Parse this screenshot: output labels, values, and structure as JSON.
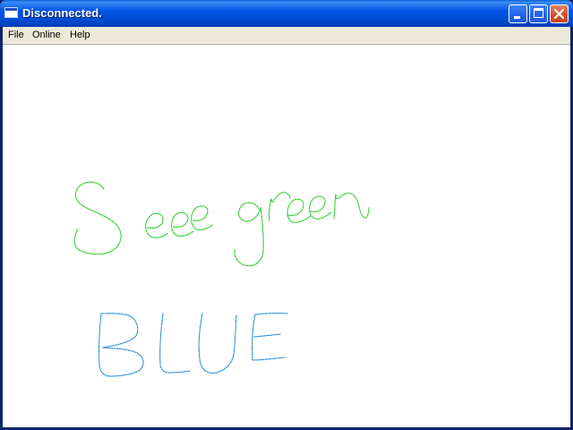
{
  "window": {
    "title": "Disconnected."
  },
  "menu": {
    "items": [
      "File",
      "Online",
      "Help"
    ]
  },
  "drawing": {
    "strokes": [
      {
        "word": "See green",
        "color": "#22cc22"
      },
      {
        "word": "BLUE",
        "color": "#2288dd"
      }
    ]
  },
  "colors": {
    "titlebar": "#0055e5",
    "menubar": "#ece9d8",
    "canvas": "#ffffff"
  },
  "icons": [
    "app-icon",
    "minimize-icon",
    "maximize-icon",
    "close-icon"
  ]
}
